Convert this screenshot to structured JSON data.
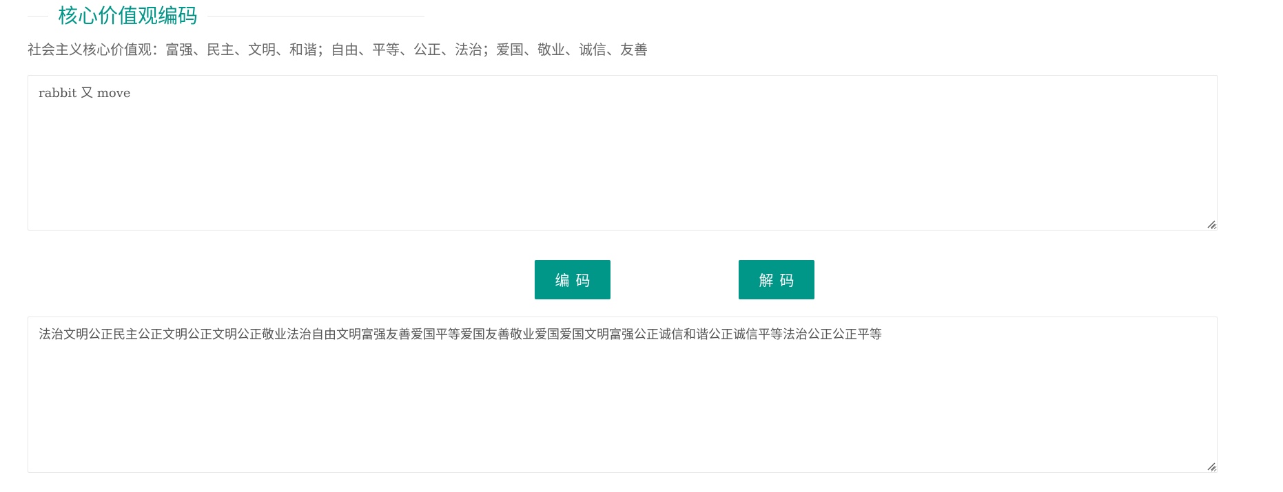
{
  "header": {
    "title": "核心价值观编码",
    "subtitle": "社会主义核心价值观：富强、民主、文明、和谐；自由、平等、公正、法治；爱国、敬业、诚信、友善"
  },
  "input": {
    "value": "rabbit 又 move"
  },
  "actions": {
    "encode_label": "编码",
    "decode_label": "解码"
  },
  "output": {
    "value": "法治文明公正民主公正文明公正文明公正敬业法治自由文明富强友善爱国平等爱国友善敬业爱国爱国文明富强公正诚信和谐公正诚信平等法治公正公正平等"
  },
  "colors": {
    "accent": "#009688",
    "border": "#e6e6e6",
    "text": "#666666"
  }
}
